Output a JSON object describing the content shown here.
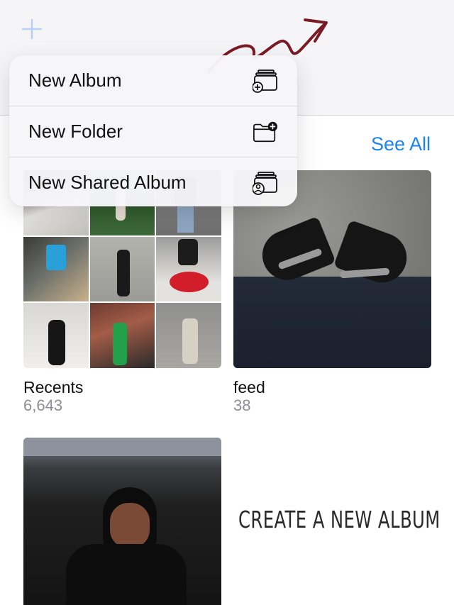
{
  "toolbar": {
    "add_icon": "plus-icon"
  },
  "menu": {
    "items": [
      {
        "label": "New Album",
        "icon": "album-add-icon"
      },
      {
        "label": "New Folder",
        "icon": "folder-add-icon"
      },
      {
        "label": "New Shared Album",
        "icon": "shared-album-icon"
      }
    ]
  },
  "section": {
    "see_all": "See All"
  },
  "albums": [
    {
      "title": "Recents",
      "count": "6,643"
    },
    {
      "title": "feed",
      "count": "38"
    }
  ],
  "overlay_caption": "CREATE A NEW ALBUM",
  "colors": {
    "accent": "#1a84f0",
    "arrow": "#7a1a24"
  }
}
